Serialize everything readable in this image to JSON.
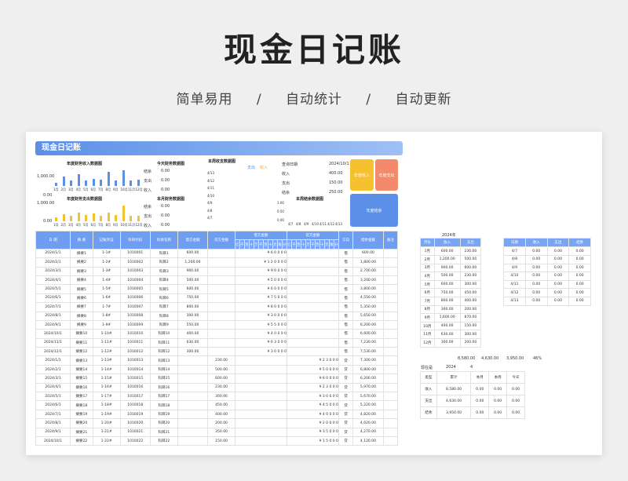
{
  "hero": {
    "title": "现金日记账",
    "features": [
      "简单易用",
      "/",
      "自动统计",
      "/",
      "自动更新"
    ]
  },
  "sheet": {
    "banner": "现金日记账",
    "income_chart": {
      "title": "年度财务收入数据图",
      "ylabels": [
        "1,000.00",
        "0.00"
      ],
      "months": [
        "1月",
        "2月",
        "3月",
        "4月",
        "5月",
        "6月",
        "7月",
        "8月",
        "9月",
        "10月",
        "11月",
        "12月"
      ],
      "values": [
        0.2,
        0.55,
        0.3,
        0.7,
        0.3,
        0.4,
        0.35,
        0.8,
        0.3,
        0.9,
        0.3,
        0.35
      ]
    },
    "expense_chart": {
      "title": "年度财务支出数据图",
      "ylabels": [
        "1,000.00",
        "0.00"
      ],
      "months": [
        "1月",
        "2月",
        "3月",
        "4月",
        "5月",
        "6月",
        "7月",
        "8月",
        "9月",
        "10月",
        "11月",
        "12月"
      ],
      "values": [
        0.25,
        0.4,
        0.3,
        0.5,
        0.35,
        0.45,
        0.3,
        0.5,
        0.35,
        0.9,
        0.3,
        0.3
      ]
    },
    "today": {
      "title": "今天财务数据图",
      "rows": [
        [
          "结余",
          "0.00"
        ],
        [
          "支出",
          "0.00"
        ],
        [
          "收入",
          "0.00"
        ]
      ]
    },
    "month": {
      "title": "本月财务数据图",
      "rows": [
        [
          "结余",
          "0.00"
        ],
        [
          "支出",
          "0.00"
        ],
        [
          "收入",
          "0.00"
        ]
      ]
    },
    "week": {
      "title": "本周收支数据图",
      "legend": [
        "支出",
        "收入"
      ],
      "dates": [
        "4/13",
        "4/12",
        "4/11",
        "4/10",
        "4/9",
        "4/8",
        "4/7"
      ]
    },
    "week_balance": {
      "title": "本周结余数据图",
      "ylabels": [
        "1.00",
        "0.50",
        "0.00"
      ],
      "dates": [
        "4/7",
        "4/8",
        "4/9",
        "4/10",
        "4/11",
        "4/12",
        "4/13"
      ]
    },
    "query": {
      "rows": [
        [
          "查询日期",
          "2024/10/1"
        ],
        [
          "收入",
          "400.00"
        ],
        [
          "支出",
          "150.00"
        ],
        [
          "结余",
          "250.00"
        ]
      ]
    },
    "boxes": {
      "income": "年度收入",
      "expense": "年度支出",
      "balance": "年度结余"
    },
    "main_headers": [
      "日 期",
      "摘 要",
      "记账凭证",
      "科目代码",
      "科目名称",
      "借方金额",
      "贷方金额",
      "借方金额",
      "贷方金额",
      "方向",
      "结余金额",
      "备注"
    ],
    "digit_headers": [
      "亿",
      "千",
      "百",
      "十",
      "万",
      "千",
      "百",
      "十",
      "元",
      "角",
      "分"
    ],
    "rows": [
      [
        "2024/1/1",
        "摘要1",
        "1-1#",
        "1010001",
        "科目1",
        "600.00",
        "",
        "¥ 6 0 0 0 0",
        "",
        "借",
        "600.00"
      ],
      [
        "2024/2/1",
        "摘要2",
        "1-2#",
        "1010002",
        "科目2",
        "1,200.00",
        "",
        "¥ 1 2 0 0 0 0",
        "",
        "借",
        "1,800.00"
      ],
      [
        "2024/3/1",
        "摘要3",
        "1-3#",
        "1010003",
        "科目3",
        "900.00",
        "",
        "¥ 9 0 0 0 0",
        "",
        "借",
        "2,700.00"
      ],
      [
        "2024/4/1",
        "摘要4",
        "1-4#",
        "1010004",
        "科目4",
        "500.00",
        "",
        "¥ 5 0 0 0 0",
        "",
        "借",
        "3,200.00"
      ],
      [
        "2024/5/1",
        "摘要5",
        "1-5#",
        "1010005",
        "科目5",
        "600.00",
        "",
        "¥ 6 0 0 0 0",
        "",
        "借",
        "3,800.00"
      ],
      [
        "2024/6/1",
        "摘要6",
        "1-6#",
        "1010006",
        "科目6",
        "750.00",
        "",
        "¥ 7 5 0 0 0",
        "",
        "借",
        "4,550.00"
      ],
      [
        "2024/7/1",
        "摘要7",
        "1-7#",
        "1010007",
        "科目7",
        "800.00",
        "",
        "¥ 8 0 0 0 0",
        "",
        "借",
        "5,350.00"
      ],
      [
        "2024/8/1",
        "摘要8",
        "1-8#",
        "1010008",
        "科目8",
        "300.00",
        "",
        "¥ 3 0 0 0 0",
        "",
        "借",
        "5,650.00"
      ],
      [
        "2024/9/1",
        "摘要9",
        "1-9#",
        "1010009",
        "科目9",
        "550.00",
        "",
        "¥ 5 5 0 0 0",
        "",
        "借",
        "6,200.00"
      ],
      [
        "2024/10/1",
        "摘要10",
        "1-10#",
        "1010010",
        "科目10",
        "400.00",
        "",
        "¥ 4 0 0 0 0",
        "",
        "借",
        "6,600.00"
      ],
      [
        "2024/11/1",
        "摘要11",
        "1-11#",
        "1010011",
        "科目11",
        "630.00",
        "",
        "¥ 6 3 0 0 0",
        "",
        "借",
        "7,230.00"
      ],
      [
        "2024/12/1",
        "摘要12",
        "1-12#",
        "1010012",
        "科目12",
        "300.00",
        "",
        "¥ 3 0 0 0 0",
        "",
        "借",
        "7,530.00"
      ],
      [
        "2024/1/1",
        "摘要13",
        "1-13#",
        "1010013",
        "科目13",
        "",
        "230.00",
        "",
        "¥ 2 3 0 0 0",
        "贷",
        "7,300.00"
      ],
      [
        "2024/2/1",
        "摘要14",
        "1-14#",
        "1010014",
        "科目14",
        "",
        "500.00",
        "",
        "¥ 5 0 0 0 0",
        "贷",
        "6,800.00"
      ],
      [
        "2024/3/1",
        "摘要15",
        "1-15#",
        "1010015",
        "科目15",
        "",
        "600.00",
        "",
        "¥ 6 0 0 0 0",
        "贷",
        "6,200.00"
      ],
      [
        "2024/4/1",
        "摘要16",
        "1-16#",
        "1010016",
        "科目16",
        "",
        "230.00",
        "",
        "¥ 2 3 0 0 0",
        "贷",
        "5,970.00"
      ],
      [
        "2024/5/1",
        "摘要17",
        "1-17#",
        "1010017",
        "科目17",
        "",
        "300.00",
        "",
        "¥ 3 0 0 0 0",
        "贷",
        "5,670.00"
      ],
      [
        "2024/6/1",
        "摘要18",
        "1-18#",
        "1010018",
        "科目18",
        "",
        "450.00",
        "",
        "¥ 4 5 0 0 0",
        "贷",
        "5,220.00"
      ],
      [
        "2024/7/1",
        "摘要19",
        "1-19#",
        "1010019",
        "科目19",
        "",
        "400.00",
        "",
        "¥ 4 0 0 0 0",
        "贷",
        "4,820.00"
      ],
      [
        "2024/8/1",
        "摘要20",
        "1-20#",
        "1010020",
        "科目20",
        "",
        "200.00",
        "",
        "¥ 2 0 0 0 0",
        "贷",
        "4,620.00"
      ],
      [
        "2024/9/1",
        "摘要21",
        "1-21#",
        "1010021",
        "科目21",
        "",
        "350.00",
        "",
        "¥ 3 5 0 0 0",
        "贷",
        "4,270.00"
      ],
      [
        "2024/10/1",
        "摘要22",
        "1-22#",
        "1010022",
        "科目22",
        "",
        "150.00",
        "",
        "¥ 1 5 0 0 0",
        "贷",
        "4,120.00"
      ]
    ],
    "year_table": {
      "title": "2024年",
      "headers": [
        "月份",
        "收入",
        "支出"
      ],
      "rows": [
        [
          "1月",
          "600.00",
          "230.00"
        ],
        [
          "2月",
          "1,200.00",
          "500.00"
        ],
        [
          "3月",
          "900.00",
          "600.00"
        ],
        [
          "4月",
          "500.00",
          "230.00"
        ],
        [
          "5月",
          "600.00",
          "300.00"
        ],
        [
          "6月",
          "750.00",
          "450.00"
        ],
        [
          "7月",
          "800.00",
          "400.00"
        ],
        [
          "8月",
          "300.00",
          "200.00"
        ],
        [
          "9月",
          "1,600.00",
          "870.00"
        ],
        [
          "10月",
          "400.00",
          "150.00"
        ],
        [
          "11月",
          "630.00",
          "300.00"
        ],
        [
          "12月",
          "300.00",
          "200.00"
        ]
      ],
      "totals": [
        "",
        "8,580.00",
        "4,630.00",
        "3,950.00",
        "46%"
      ]
    },
    "week_table": {
      "headers": [
        "日期",
        "收入",
        "支出",
        "结余"
      ],
      "rows": [
        [
          "4/7",
          "0.00",
          "0.00",
          "0.00"
        ],
        [
          "4/8",
          "0.00",
          "0.00",
          "0.00"
        ],
        [
          "4/9",
          "0.00",
          "0.00",
          "0.00"
        ],
        [
          "4/10",
          "0.00",
          "0.00",
          "0.00"
        ],
        [
          "4/11",
          "0.00",
          "0.00",
          "0.00"
        ],
        [
          "4/12",
          "0.00",
          "0.00",
          "0.00"
        ],
        [
          "4/13",
          "0.00",
          "0.00",
          "0.00"
        ]
      ]
    },
    "now": {
      "label": "现在是",
      "year": "2024",
      "month": "4"
    },
    "summary": {
      "headers": [
        "类型",
        "累计",
        "本月",
        "本周",
        "今天"
      ],
      "rows": [
        [
          "收入",
          "8,580.00",
          "0.00",
          "0.00",
          "0.00"
        ],
        [
          "支出",
          "4,630.00",
          "0.00",
          "0.00",
          "0.00"
        ],
        [
          "结余",
          "3,950.00",
          "0.00",
          "0.00",
          "0.00"
        ]
      ]
    }
  },
  "colors": {
    "blue": "#5b8fe8",
    "yellow": "#f5c12e",
    "orange": "#f28a6b",
    "header": "#6f9ef0"
  }
}
